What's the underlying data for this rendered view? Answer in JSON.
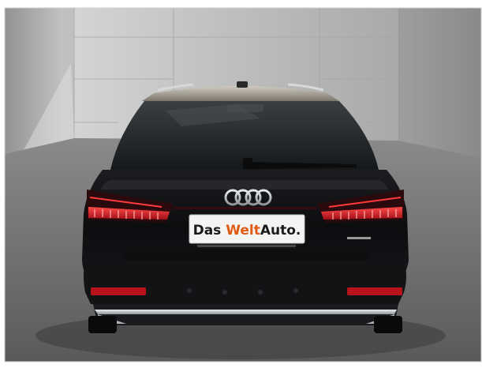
{
  "photo": {
    "subject": "car-rear-view",
    "brand_mark": "audi-rings",
    "plate": {
      "part1": "Das ",
      "part2": "Welt",
      "part3": "Auto.",
      "color_text": "#1a1a1a",
      "color_accent": "#e05a14"
    },
    "colors": {
      "wall": "#b9b9b9",
      "floor": "#6f6f6f",
      "body": "#111214",
      "glass": "#1f2326",
      "light": "#e0202a",
      "chrome": "#cfd3d6"
    }
  }
}
